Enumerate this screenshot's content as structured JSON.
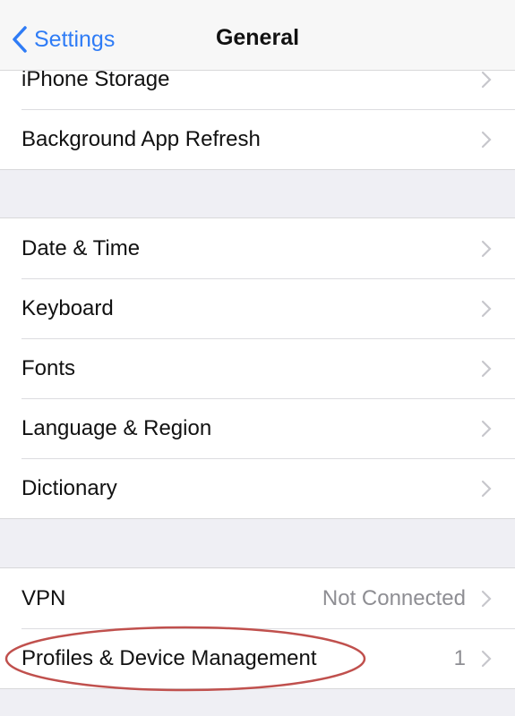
{
  "nav": {
    "back_label": "Settings",
    "title": "General"
  },
  "groups": [
    {
      "items": [
        {
          "label": "iPhone Storage",
          "value": ""
        },
        {
          "label": "Background App Refresh",
          "value": ""
        }
      ]
    },
    {
      "items": [
        {
          "label": "Date & Time",
          "value": ""
        },
        {
          "label": "Keyboard",
          "value": ""
        },
        {
          "label": "Fonts",
          "value": ""
        },
        {
          "label": "Language & Region",
          "value": ""
        },
        {
          "label": "Dictionary",
          "value": ""
        }
      ]
    },
    {
      "items": [
        {
          "label": "VPN",
          "value": "Not Connected"
        },
        {
          "label": "Profiles & Device Management",
          "value": "1"
        }
      ]
    }
  ],
  "annotation": {
    "highlighted_item": "Profiles & Device Management",
    "color": "#c0504d"
  },
  "colors": {
    "accent": "#2f7cf6",
    "chevron": "#c7c7cc"
  }
}
